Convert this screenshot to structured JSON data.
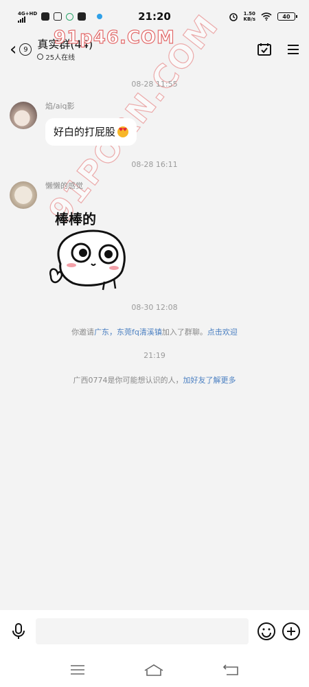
{
  "status_bar": {
    "network": "4G+HD",
    "time": "21:20",
    "speed_value": "1.50",
    "speed_unit": "KB/s",
    "battery": "40"
  },
  "header": {
    "back_badge": "9",
    "title": "真实群(44)",
    "online": "25人在线",
    "watermark": "91p46.COM"
  },
  "watermark_diag": "91PORN.COM",
  "messages": [
    {
      "time": "08-28 11:55",
      "sender": "焰/aiq影",
      "text": "好白的打屁股",
      "emoji": "star-struck-emoji"
    },
    {
      "time": "08-28 16:11",
      "sender": "懒懒的感觉",
      "sticker_text": "棒棒的"
    }
  ],
  "system": [
    {
      "time": "08-30 12:08",
      "pre": "你邀请",
      "names": "广东，东莞fq清溪镇",
      "mid": "加入了群聊。",
      "action": "点击欢迎"
    },
    {
      "time": "21:19",
      "pre": "广西0774是你可能想认识的人，",
      "action": "加好友了解更多"
    }
  ],
  "input": {
    "placeholder": ""
  },
  "colors": {
    "background": "#f3f3f3",
    "link": "#4a7fc1",
    "watermark": "#e26a6a"
  }
}
